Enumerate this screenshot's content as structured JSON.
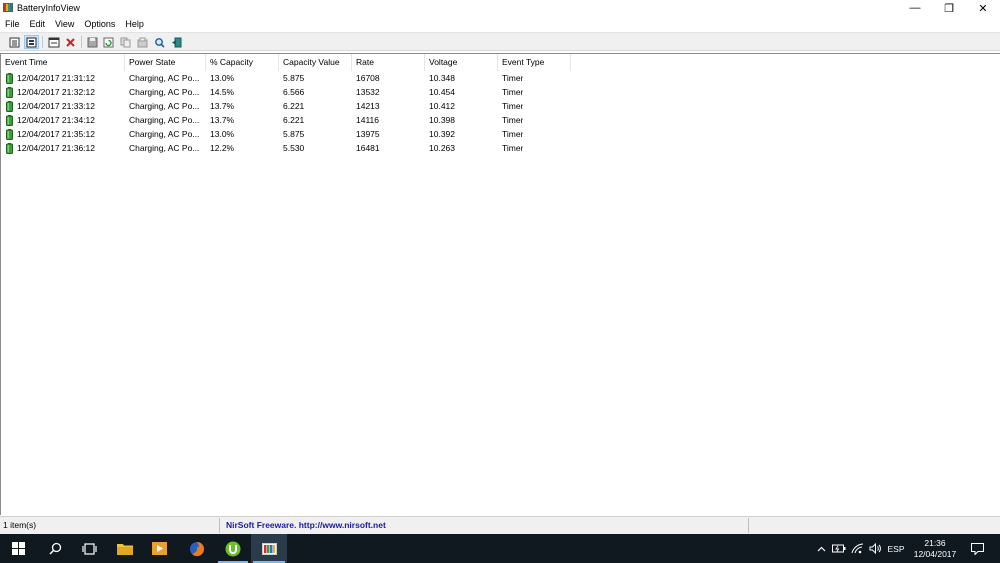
{
  "window": {
    "title": "BatteryInfoView",
    "controls": {
      "minimize": "—",
      "restore": "❐",
      "close": "✕"
    }
  },
  "menu": [
    "File",
    "Edit",
    "View",
    "Options",
    "Help"
  ],
  "toolbar": {
    "icons": [
      "properties-icon",
      "battery-info-icon",
      "log-window-icon",
      "delete-icon",
      "save-icon",
      "refresh-icon",
      "copy-icon",
      "html-report-icon",
      "find-icon",
      "exit-icon"
    ]
  },
  "table": {
    "columns": [
      "Event Time",
      "Power State",
      "% Capacity",
      "Capacity Value",
      "Rate",
      "Voltage",
      "Event Type"
    ],
    "rows": [
      [
        "12/04/2017 21:31:12",
        "Charging, AC Po...",
        "13.0%",
        "5.875",
        "16708",
        "10.348",
        "Timer"
      ],
      [
        "12/04/2017 21:32:12",
        "Charging, AC Po...",
        "14.5%",
        "6.566",
        "13532",
        "10.454",
        "Timer"
      ],
      [
        "12/04/2017 21:33:12",
        "Charging, AC Po...",
        "13.7%",
        "6.221",
        "14213",
        "10.412",
        "Timer"
      ],
      [
        "12/04/2017 21:34:12",
        "Charging, AC Po...",
        "13.7%",
        "6.221",
        "14116",
        "10.398",
        "Timer"
      ],
      [
        "12/04/2017 21:35:12",
        "Charging, AC Po...",
        "13.0%",
        "5.875",
        "13975",
        "10.392",
        "Timer"
      ],
      [
        "12/04/2017 21:36:12",
        "Charging, AC Po...",
        "12.2%",
        "5.530",
        "16481",
        "10.263",
        "Timer"
      ]
    ]
  },
  "status": {
    "items": "1 item(s)",
    "credit": "NirSoft Freeware.  http://www.nirsoft.net"
  },
  "taskbar": {
    "apps": [
      "start-icon",
      "search-icon",
      "task-view-icon",
      "file-explorer-icon",
      "media-player-icon",
      "firefox-icon",
      "utorrent-icon",
      "batteryinfoview-icon"
    ],
    "language": "ESP",
    "time": "21:36",
    "date": "12/04/2017"
  },
  "colors": {
    "battery_green": "#3aa03a",
    "taskbar_bg": "#101820",
    "nirsoft_link": "#1a1aa6"
  }
}
